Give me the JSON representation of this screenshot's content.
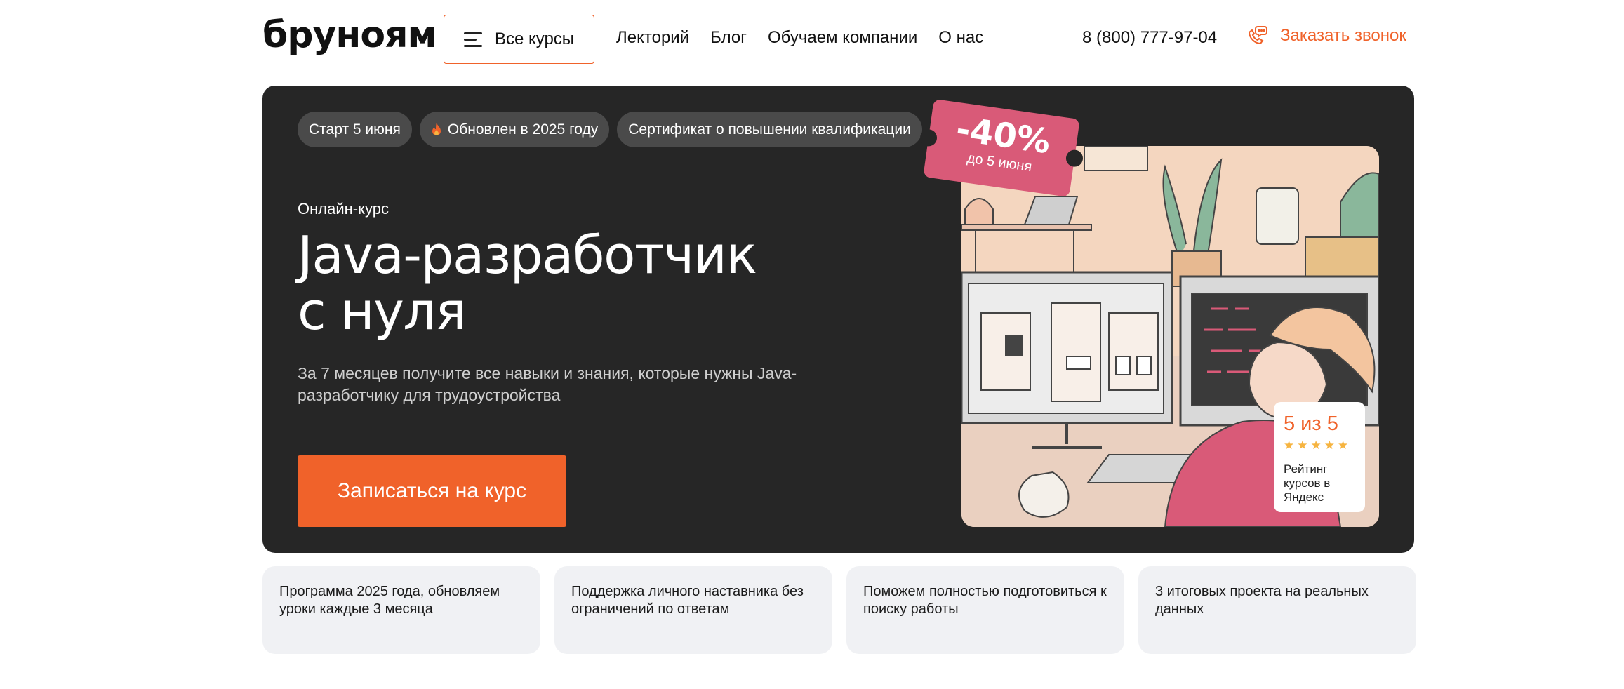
{
  "header": {
    "logo": "бруноям",
    "all_courses": "Все курсы",
    "nav": [
      "Лекторий",
      "Блог",
      "Обучаем компании",
      "О нас"
    ],
    "phone": "8 (800) 777-97-04",
    "callback": "Заказать звонок"
  },
  "hero": {
    "tags": [
      {
        "label": "Старт 5 июня",
        "icon": null
      },
      {
        "label": "Обновлен в 2025 году",
        "icon": "flame-icon"
      },
      {
        "label": "Сертификат о повышении квалификации",
        "icon": null
      }
    ],
    "kicker": "Онлайн-курс",
    "title_line1": "Java-разработчик",
    "title_line2": "с нуля",
    "subtitle": "За 7 месяцев получите все навыки и знания, которые нужны Java-разработчику для трудоустройства",
    "cta": "Записаться на курс",
    "discount": {
      "value": "-40%",
      "until": "до 5 июня"
    },
    "rating": {
      "score": "5 из 5",
      "stars": 5,
      "label": "Рейтинг курсов в Яндекс"
    }
  },
  "features": [
    "Программа 2025 года, обновляем уроки каждые 3 месяца",
    "Поддержка личного наставника без ограничений по ответам",
    "Поможем полностью подготовиться к поиску работы",
    "3 итоговых проекта на реальных данных"
  ],
  "colors": {
    "accent": "#f0622a",
    "hero_bg": "#262626",
    "tag_bg": "#4a4a4a",
    "sticker": "#d95a78",
    "feature_bg": "#f0f1f4",
    "star": "#f6b440"
  }
}
